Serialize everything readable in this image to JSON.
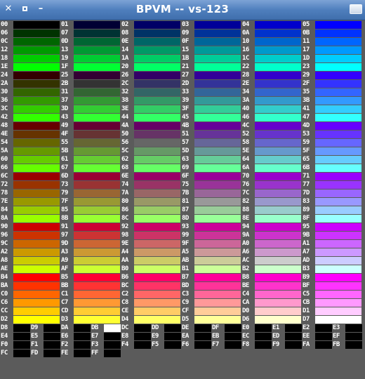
{
  "window": {
    "title": "BPVM -- vs-123"
  },
  "controls": {
    "close_icon": "close-icon",
    "maximize_icon": "maximize-icon",
    "minimize_icon": "minimize-icon",
    "right_icon": "window-menu-icon"
  },
  "palette": {
    "columns": 6,
    "extended_columns": 3,
    "codes_start": 0,
    "codes_end": 255,
    "label_color": "#ffffff",
    "background": "#5b5b5b"
  }
}
